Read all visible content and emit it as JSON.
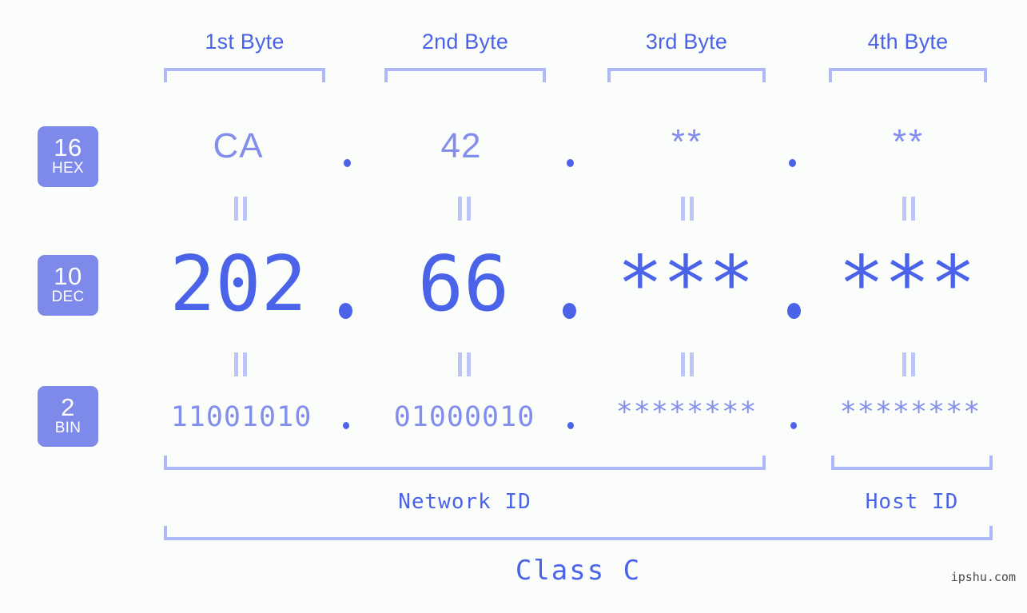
{
  "meta": {
    "background_color": "#fbfdfa",
    "accent_strong": "#4a63e8",
    "accent_light": "#838eec",
    "bracket_color": "#aeb8f7",
    "badge_color": "#7e8ae9",
    "watermark": "ipshu.com"
  },
  "headers": [
    {
      "label": "1st Byte"
    },
    {
      "label": "2nd Byte"
    },
    {
      "label": "3rd Byte"
    },
    {
      "label": "4th Byte"
    }
  ],
  "bases": [
    {
      "num": "16",
      "sys": "HEX"
    },
    {
      "num": "10",
      "sys": "DEC"
    },
    {
      "num": "2",
      "sys": "BIN"
    }
  ],
  "rows": {
    "hex": {
      "base": "16",
      "system": "HEX",
      "values": [
        "CA",
        "42",
        "**",
        "**"
      ]
    },
    "dec": {
      "base": "10",
      "system": "DEC",
      "values": [
        "202",
        "66",
        "***",
        "***"
      ]
    },
    "bin": {
      "base": "2",
      "system": "BIN",
      "values": [
        "11001010",
        "01000010",
        "********",
        "********"
      ]
    }
  },
  "separators": {
    "dot": ".",
    "equals": "||"
  },
  "segments": {
    "network_id": "Network ID",
    "host_id": "Host ID"
  },
  "class": {
    "label": "Class C"
  }
}
